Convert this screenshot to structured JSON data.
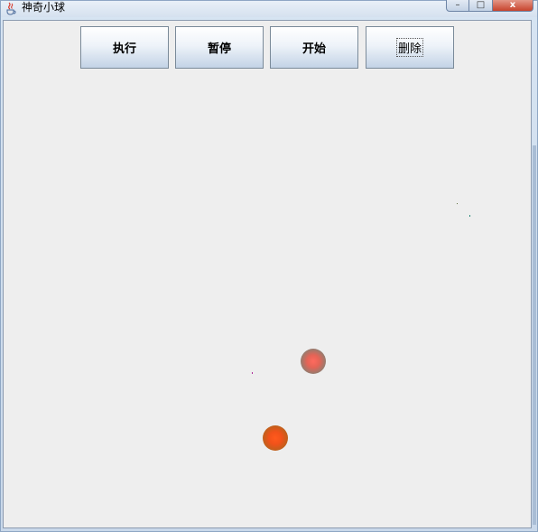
{
  "window": {
    "title": "神奇小球",
    "controls": {
      "minimize": "–",
      "maximize": "□",
      "close": "x"
    }
  },
  "toolbar": {
    "buttons": [
      {
        "label": "执行"
      },
      {
        "label": "暂停"
      },
      {
        "label": "开始"
      },
      {
        "label": "删除"
      }
    ]
  },
  "canvas": {
    "balls": [
      {
        "color": "#e46456"
      },
      {
        "color": "#f1521a"
      }
    ],
    "particles": [
      {
        "color": "#5a6b3a"
      },
      {
        "color": "#2a8a7a"
      },
      {
        "color": "#b02a9a"
      }
    ]
  },
  "colors": {
    "content_bg": "#eeeeee",
    "button_gradient_top": "#ffffff",
    "button_gradient_bottom": "#c3d3e6",
    "close_button": "#c7432c"
  },
  "icons": {
    "app": "java-coffee-cup-icon"
  }
}
